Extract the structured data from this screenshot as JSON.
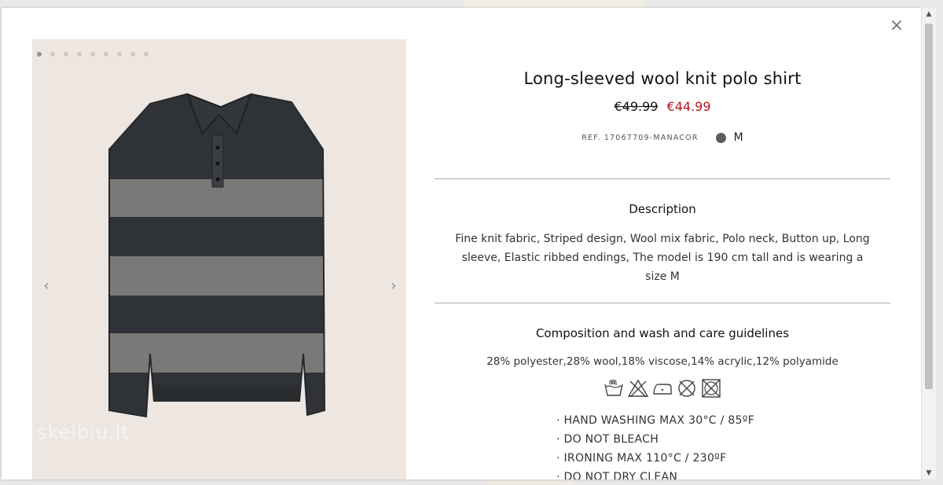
{
  "modal": {
    "close_label": "×",
    "gallery": {
      "dot_count": 9,
      "active_dot": 0,
      "prev_label": "‹",
      "next_label": "›",
      "watermark": "skelbiu.lt"
    },
    "product": {
      "title": "Long-sleeved wool knit polo shirt",
      "old_price": "€49.99",
      "new_price": "€44.99",
      "ref": "REF. 17067709-MANACOR",
      "color": "#5d5d5d",
      "size": "M"
    },
    "description": {
      "heading": "Description",
      "text": "Fine knit fabric, Striped design, Wool mix fabric, Polo neck, Button up, Long sleeve, Elastic ribbed endings, The model is 190 cm tall and is wearing a size M"
    },
    "composition": {
      "heading": "Composition and wash and care guidelines",
      "text": "28% polyester,28% wool,18% viscose,14% acrylic,12% polyamide",
      "care_icons": [
        "hand-wash-icon",
        "no-bleach-icon",
        "iron-icon",
        "no-dry-clean-icon",
        "no-tumble-dry-icon"
      ],
      "care_items": [
        "· HAND WASHING MAX 30°C / 85ºF",
        "· DO NOT BLEACH",
        "· IRONING MAX 110°C / 230ºF",
        "· DO NOT DRY CLEAN"
      ]
    }
  }
}
